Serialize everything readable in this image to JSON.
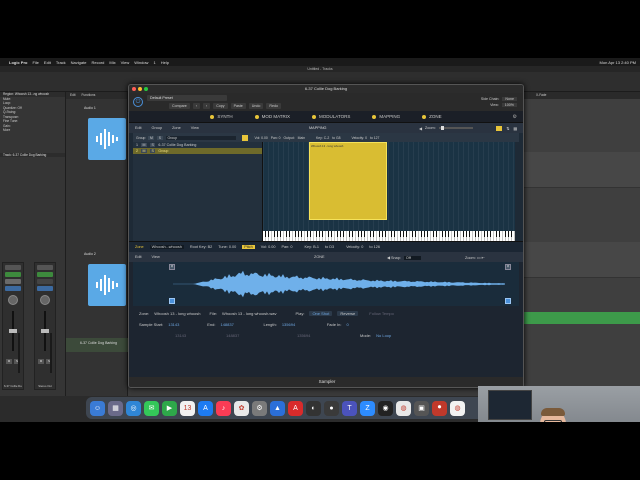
{
  "menubar": {
    "app": "Logic Pro",
    "items": [
      "File",
      "Edit",
      "Track",
      "Navigate",
      "Record",
      "Mix",
      "View",
      "Window",
      "1",
      "Help"
    ],
    "clock": "Mon Apr 13  2:40 PM"
  },
  "logic": {
    "window_title": "Untitled - Tracks",
    "inspector": {
      "region_row": "Region: Whoosh 13...ng whoosh",
      "rows": [
        "Mute:",
        "Loop:",
        "Quantize: Off",
        "Q-Swing:",
        "Transpose:",
        "Fine Tune:",
        "Gain:",
        "More"
      ],
      "track_row": "Track: 6-37 Collie Dog Barking"
    },
    "strips": [
      {
        "name": "6-37 Collie Dog Barking",
        "btn_top": "Setting",
        "btn_green": "EQ",
        "btn_sampler": "Sampler",
        "btn_blue": "Stereo Out",
        "m": "M",
        "s": "S"
      },
      {
        "name": "Stereo Out",
        "btn_top": "Setting",
        "btn_green": "EQ",
        "btn_sampler": "",
        "btn_blue": "Bnce",
        "m": "M",
        "s": "S"
      }
    ],
    "tracklist_header": [
      "Edit",
      "Functions"
    ],
    "tracks": [
      {
        "label": "Audio 1"
      },
      {
        "label": "Audio 2"
      }
    ],
    "track3_label": "6-37 Collie Dog Barking",
    "arrange_ruler": "X-Fade",
    "colors": {
      "audio_region": "#5aa9e6",
      "midi_region": "#3d9a4a",
      "accent": "#e8c53a"
    }
  },
  "sampler": {
    "title": "6-37 Collie Dog Barking",
    "preset": "Default Preset",
    "toolbar": [
      "Compare",
      "Copy",
      "Paste",
      "Undo",
      "Redo"
    ],
    "side_chain_label": "Side Chain:",
    "side_chain_value": "None",
    "view_label": "View:",
    "view_value": "100%",
    "tabs": [
      {
        "label": "SYNTH"
      },
      {
        "label": "MOD MATRIX"
      },
      {
        "label": "MODULATORS"
      },
      {
        "label": "MAPPING"
      },
      {
        "label": "ZONE"
      }
    ],
    "mapping": {
      "menus": [
        "Edit",
        "Group",
        "Zone",
        "View"
      ],
      "title": "MAPPING",
      "zoom_label": "Zoom:",
      "group_row": {
        "label": "Group",
        "m": "M",
        "s": "S",
        "name": "Group",
        "vol": "Vol: 0.00",
        "pan": "Pan: 0",
        "output": "Output:",
        "output_val": "Main",
        "key": "Key: C-2",
        "key_to": "to G8",
        "velocity": "Velocity: 0",
        "vel_to": "to 127"
      },
      "group_list": [
        {
          "num": "1",
          "m": "M",
          "s": "S",
          "name": "6-37 Collie Dog Barking",
          "selected": false
        },
        {
          "num": "2",
          "m": "M",
          "s": "S",
          "name": "Group",
          "selected": true
        }
      ],
      "zone_label": "Whoosh 13 - long whoosh"
    },
    "zone_bar": {
      "label": "Zone",
      "name": "Whoosh...whoosh",
      "root_key": "Root Key: B2",
      "tune": "Tune: 0.00",
      "pitch": "Pitch",
      "vol": "Vol: 0.00",
      "pan": "Pan: 0",
      "key": "Key: B-1",
      "key_to": "to D3",
      "velocity": "Velocity: 0",
      "vel_to": "to 126"
    },
    "zone_editor": {
      "menus": [
        "Edit",
        "View"
      ],
      "title": "ZONE",
      "snap_label": "Snap:",
      "snap_value": "Off",
      "zoom_label": "Zoom:",
      "marker_start": "S",
      "marker_end": "E",
      "zone_name_label": "Zone:",
      "zone_name": "Whoosh 13 - long whoosh",
      "file_label": "File:",
      "file_name": "Whoosh 13 - long whoosh.wav",
      "play_label": "Play:",
      "play_modes": [
        "One Shot",
        "Reverse"
      ],
      "follow_tempo": "Follow Tempo",
      "sample_start_label": "Sample Start:",
      "sample_start": "13143",
      "end_label": "End:",
      "end": "148837",
      "length_label": "Length:",
      "length": "135694",
      "fade_in_label": "Fade In:",
      "fade_in": "0",
      "loop_start": "13143",
      "loop_end": "148837",
      "loop_length": "135694",
      "mode_label": "Mode:",
      "mode_value": "No Loop"
    },
    "footer": "Sampler"
  },
  "dock": {
    "icons": [
      {
        "name": "finder",
        "color": "#3a7bd5",
        "glyph": "☺"
      },
      {
        "name": "launchpad",
        "color": "#6a6a8a",
        "glyph": "▦"
      },
      {
        "name": "safari",
        "color": "#2f86d6",
        "glyph": "◎"
      },
      {
        "name": "messages",
        "color": "#34c759",
        "glyph": "✉"
      },
      {
        "name": "facetime",
        "color": "#2ea84a",
        "glyph": "▶"
      },
      {
        "name": "calendar",
        "color": "#f2f2f2",
        "glyph": "13"
      },
      {
        "name": "app-store",
        "color": "#1d7bf2",
        "glyph": "A"
      },
      {
        "name": "music",
        "color": "#fa3c55",
        "glyph": "♪"
      },
      {
        "name": "photos",
        "color": "#e8e8e8",
        "glyph": "✿"
      },
      {
        "name": "settings",
        "color": "#7a7a7a",
        "glyph": "⚙"
      },
      {
        "name": "keynote",
        "color": "#2b6fd9",
        "glyph": "▲"
      },
      {
        "name": "acrobat",
        "color": "#d92b2b",
        "glyph": "A"
      },
      {
        "name": "logic",
        "color": "#333",
        "glyph": "◐"
      },
      {
        "name": "camera",
        "color": "#3a3a3a",
        "glyph": "●"
      },
      {
        "name": "teams",
        "color": "#4b53bc",
        "glyph": "T"
      },
      {
        "name": "zoom",
        "color": "#2d8cff",
        "glyph": "Z"
      },
      {
        "name": "obs",
        "color": "#222",
        "glyph": "◉"
      },
      {
        "name": "chrome",
        "color": "#e8e8e8",
        "glyph": "◍"
      },
      {
        "name": "misc",
        "color": "#555",
        "glyph": "▣"
      },
      {
        "name": "screen-record",
        "color": "#c0392b",
        "glyph": "⏺"
      },
      {
        "name": "chrome-2",
        "color": "#f2f2f2",
        "glyph": "◍"
      }
    ]
  }
}
